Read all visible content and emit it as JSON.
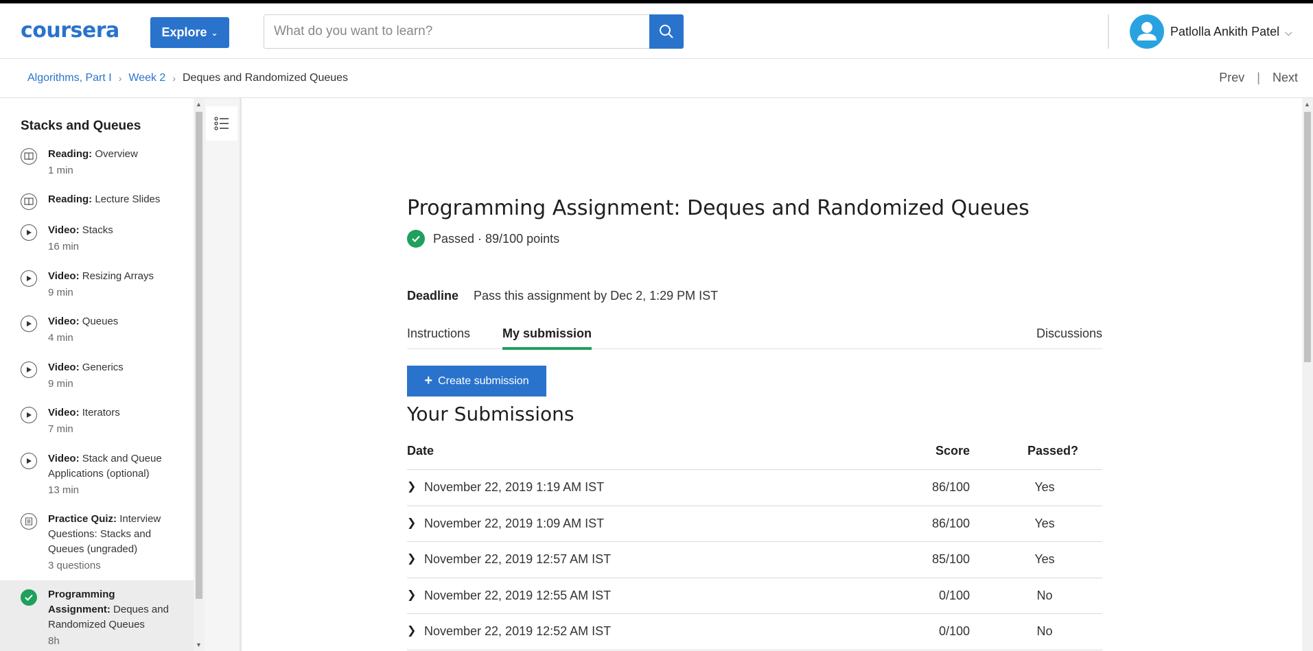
{
  "header": {
    "logo": "coursera",
    "explore_label": "Explore",
    "search_placeholder": "What do you want to learn?",
    "user_name": "Patlolla Ankith Patel"
  },
  "breadcrumb": {
    "items": [
      "Algorithms, Part I",
      "Week 2",
      "Deques and Randomized Queues"
    ],
    "prev": "Prev",
    "next": "Next"
  },
  "sidebar": {
    "title": "Stacks and Queues",
    "items": [
      {
        "type": "Reading:",
        "name": "Overview",
        "duration": "1 min",
        "icon": "book-icon"
      },
      {
        "type": "Reading:",
        "name": "Lecture Slides",
        "duration": "",
        "icon": "book-icon"
      },
      {
        "type": "Video:",
        "name": "Stacks",
        "duration": "16 min",
        "icon": "play-icon"
      },
      {
        "type": "Video:",
        "name": "Resizing Arrays",
        "duration": "9 min",
        "icon": "play-icon"
      },
      {
        "type": "Video:",
        "name": "Queues",
        "duration": "4 min",
        "icon": "play-icon"
      },
      {
        "type": "Video:",
        "name": "Generics",
        "duration": "9 min",
        "icon": "play-icon"
      },
      {
        "type": "Video:",
        "name": "Iterators",
        "duration": "7 min",
        "icon": "play-icon"
      },
      {
        "type": "Video:",
        "name": "Stack and Queue Applications (optional)",
        "duration": "13 min",
        "icon": "play-icon"
      },
      {
        "type": "Practice Quiz:",
        "name": "Interview Questions: Stacks and Queues (ungraded)",
        "duration": "3 questions",
        "icon": "quiz-icon"
      },
      {
        "type": "Programming Assignment:",
        "name": "Deques and Randomized Queues",
        "duration": "8h",
        "icon": "check-icon"
      }
    ]
  },
  "main": {
    "title": "Programming Assignment: Deques and Randomized Queues",
    "status": "Passed · 89/100 points",
    "deadline_label": "Deadline",
    "deadline_value": "Pass this assignment by Dec 2, 1:29 PM IST",
    "tabs": [
      "Instructions",
      "My submission",
      "Discussions"
    ],
    "create_label": "Create submission",
    "submissions_heading": "Your Submissions",
    "table": {
      "headers": [
        "Date",
        "Score",
        "Passed?"
      ],
      "rows": [
        {
          "date": "November 22, 2019 1:19 AM IST",
          "score": "86/100",
          "passed": "Yes"
        },
        {
          "date": "November 22, 2019 1:09 AM IST",
          "score": "86/100",
          "passed": "Yes"
        },
        {
          "date": "November 22, 2019 12:57 AM IST",
          "score": "85/100",
          "passed": "Yes"
        },
        {
          "date": "November 22, 2019 12:55 AM IST",
          "score": "0/100",
          "passed": "No"
        },
        {
          "date": "November 22, 2019 12:52 AM IST",
          "score": "0/100",
          "passed": "No"
        }
      ]
    }
  },
  "colors": {
    "brand_blue": "#2a73cc",
    "success_green": "#1fa05c"
  }
}
